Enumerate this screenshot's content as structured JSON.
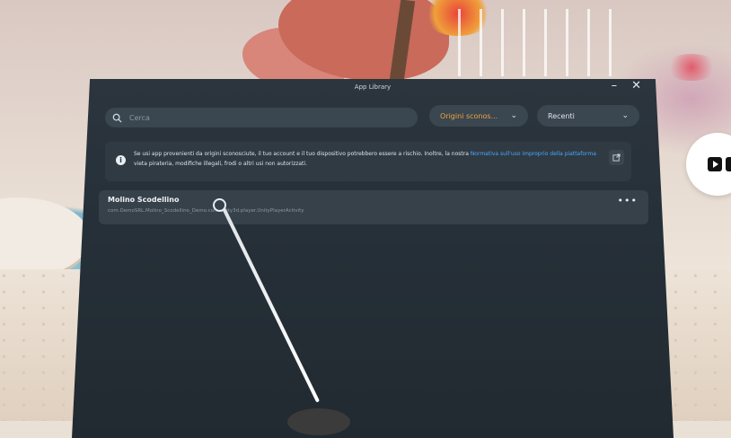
{
  "window": {
    "title": "App Library",
    "minimize_label": "–",
    "close_label": "✕"
  },
  "search": {
    "placeholder": "Cerca"
  },
  "filters": {
    "origins_label": "Origini sconos...",
    "sort_label": "Recenti"
  },
  "notice": {
    "text_1": "Se usi app provenienti da origini sconosciute, il tuo account e il tuo dispositivo potrebbero essere a rischio. Inoltre, la nostra ",
    "link_1": "Normativa sull'uso improprio della piattaforma",
    "text_2": " vieta pirateria, modifiche illegali, frodi o altri usi non autorizzati."
  },
  "apps": [
    {
      "name": "Molino Scodellino",
      "package": "com.DemoSRL.Molino_Scodellino_Demo.com.unity3d.player.UnityPlayerActivity",
      "more_label": "•••"
    }
  ],
  "icons": {
    "search": "search-icon",
    "chevron": "chevron-down-icon",
    "info": "info-icon",
    "external": "external-link-icon",
    "more": "more-icon",
    "side": "play-icon"
  },
  "colors": {
    "accent_orange": "#f0a63a",
    "link_blue": "#4aa8ff",
    "panel_bg": "#263038"
  }
}
